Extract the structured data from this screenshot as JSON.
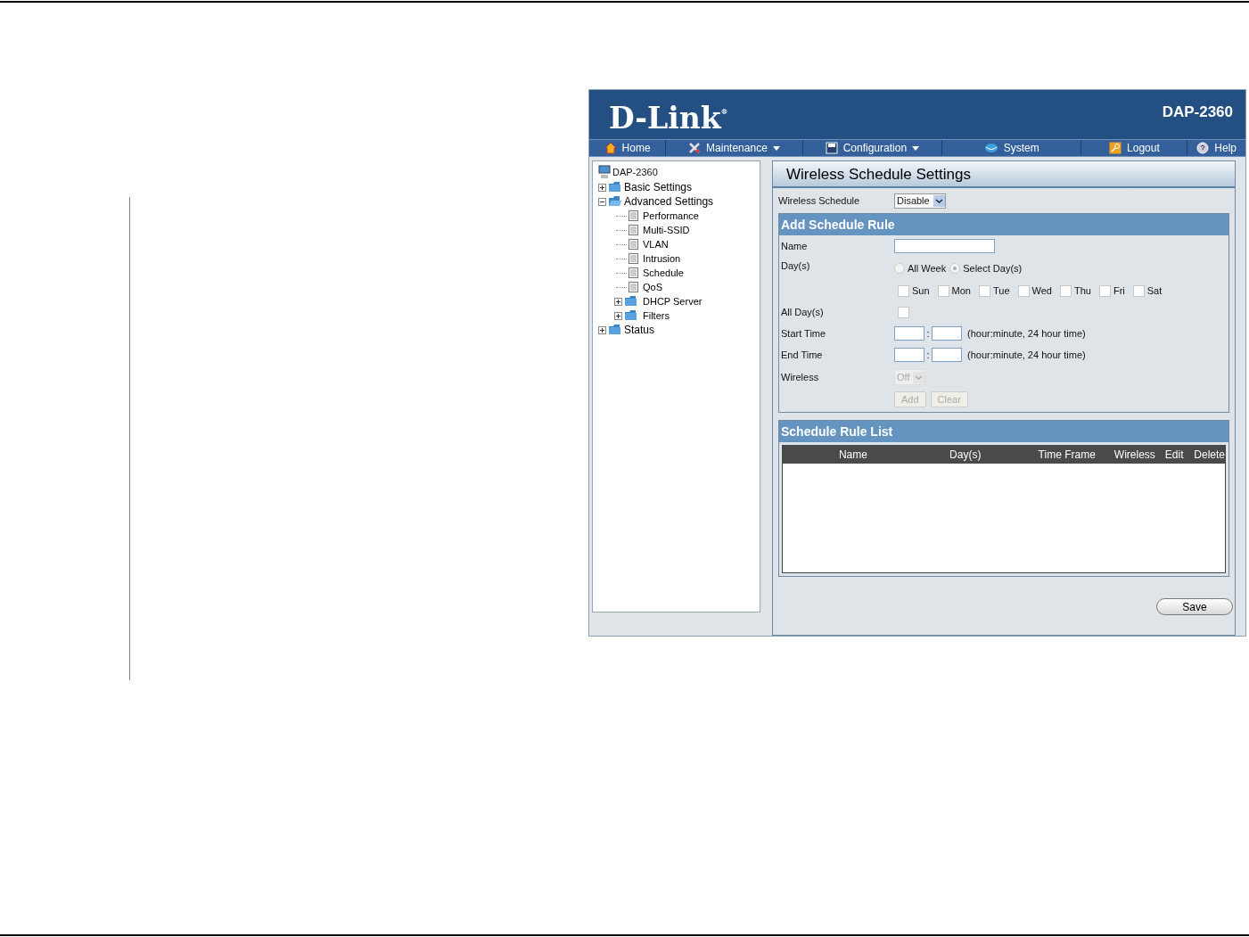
{
  "header": {
    "logo": "D-Link",
    "logo_mark": "®",
    "model": "DAP-2360"
  },
  "nav": [
    {
      "label": "Home",
      "dropdown": false
    },
    {
      "label": "Maintenance",
      "dropdown": true
    },
    {
      "label": "Configuration",
      "dropdown": true
    },
    {
      "label": "System",
      "dropdown": false
    },
    {
      "label": "Logout",
      "dropdown": false
    },
    {
      "label": "Help",
      "dropdown": false
    }
  ],
  "tree": {
    "label": "DAP-2360",
    "children": [
      {
        "label": "Basic Settings",
        "kind": "folder",
        "expanded": false
      },
      {
        "label": "Advanced Settings",
        "kind": "folder",
        "expanded": true,
        "children": [
          {
            "label": "Performance",
            "kind": "page"
          },
          {
            "label": "Multi-SSID",
            "kind": "page"
          },
          {
            "label": "VLAN",
            "kind": "page"
          },
          {
            "label": "Intrusion",
            "kind": "page"
          },
          {
            "label": "Schedule",
            "kind": "page"
          },
          {
            "label": "QoS",
            "kind": "page"
          },
          {
            "label": "DHCP Server",
            "kind": "folder",
            "expanded": false
          },
          {
            "label": "Filters",
            "kind": "folder",
            "expanded": false
          }
        ]
      },
      {
        "label": "Status",
        "kind": "folder",
        "expanded": false
      }
    ]
  },
  "page_title": "Wireless Schedule Settings",
  "wireless_schedule": {
    "label": "Wireless Schedule",
    "value": "Disable"
  },
  "add_rule": {
    "title": "Add Schedule Rule",
    "name_label": "Name",
    "days_label": "Day(s)",
    "day_modes": [
      {
        "label": "All Week",
        "selected": false
      },
      {
        "label": "Select Day(s)",
        "selected": true
      }
    ],
    "days": [
      {
        "label": "Sun",
        "checked": false
      },
      {
        "label": "Mon",
        "checked": false
      },
      {
        "label": "Tue",
        "checked": false
      },
      {
        "label": "Wed",
        "checked": false
      },
      {
        "label": "Thu",
        "checked": false
      },
      {
        "label": "Fri",
        "checked": false
      },
      {
        "label": "Sat",
        "checked": false
      }
    ],
    "all_days": {
      "label": "All Day(s)",
      "checked": false
    },
    "start": {
      "label": "Start Time",
      "separator": ":",
      "hint": "(hour:minute, 24 hour time)"
    },
    "end": {
      "label": "End Time",
      "separator": ":",
      "hint": "(hour:minute, 24 hour time)"
    },
    "wireless": {
      "label": "Wireless",
      "value": "Off",
      "disabled": true
    },
    "buttons": [
      {
        "label": "Add",
        "disabled": true
      },
      {
        "label": "Clear",
        "disabled": true
      }
    ]
  },
  "rule_list": {
    "title": "Schedule Rule List",
    "columns": [
      "Name",
      "Day(s)",
      "Time Frame",
      "Wireless",
      "Edit",
      "Delete"
    ]
  },
  "save_button": "Save"
}
